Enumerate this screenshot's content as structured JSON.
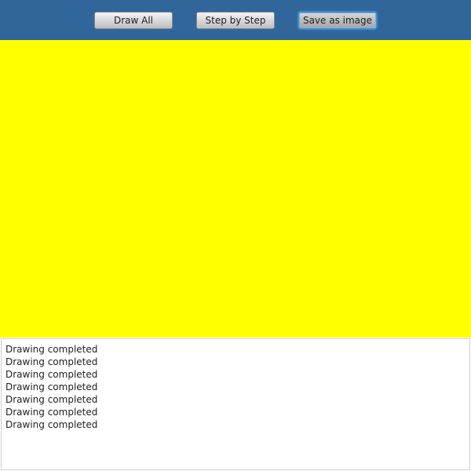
{
  "toolbar": {
    "draw_all_label": "Draw All",
    "step_by_step_label": "Step by Step",
    "save_as_image_label": "Save as image",
    "background_color": "#31669a"
  },
  "canvas": {
    "fill_color": "#ffff00"
  },
  "log": {
    "lines": [
      "Drawing completed",
      "Drawing completed",
      "Drawing completed",
      "Drawing completed",
      "Drawing completed",
      "Drawing completed",
      "Drawing completed"
    ]
  }
}
